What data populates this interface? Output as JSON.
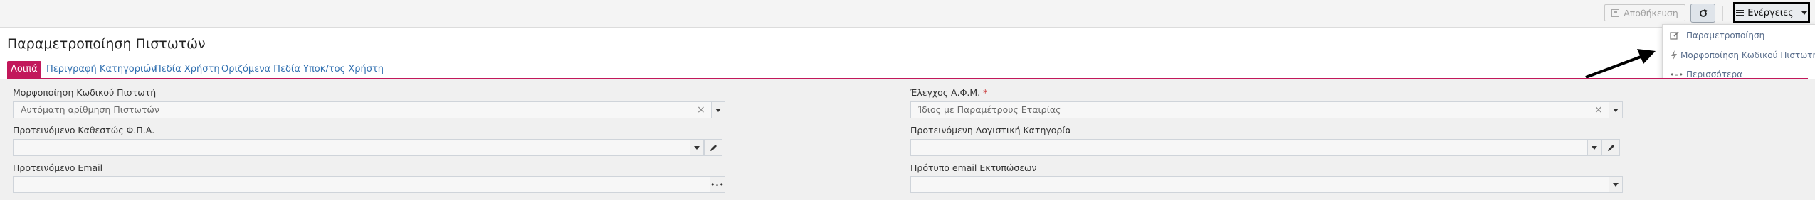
{
  "toolbar": {
    "save_label": "Αποθήκευση",
    "actions_label": "Ενέργειες"
  },
  "actions_menu": {
    "items": [
      {
        "label": "Παραμετροποίηση",
        "icon": "edit-icon"
      },
      {
        "label": "Μορφοποίηση Κωδικού Πιστωτή",
        "icon": "lightning-icon"
      },
      {
        "label": "Περισσότερα",
        "icon": "ellipsis-icon"
      }
    ]
  },
  "page": {
    "title": "Παραμετροποίηση Πιστωτών"
  },
  "tabs": [
    {
      "label": "Λοιπά",
      "active": true
    },
    {
      "label": "Περιγραφή Κατηγοριών",
      "active": false
    },
    {
      "label": "Πεδία Χρήστη",
      "active": false
    },
    {
      "label": "Οριζόμενα Πεδία Υποκ/τος Χρήστη",
      "active": false
    }
  ],
  "form": {
    "code_format": {
      "label": "Μορφοποίηση Κωδικού Πιστωτή",
      "value": "Αυτόματη αρίθμηση Πιστωτών"
    },
    "vat_check": {
      "label": "Έλεγχος Α.Φ.Μ.",
      "required_mark": "*",
      "value": "Ίδιος με Παραμέτρους Εταιρίας"
    },
    "vat_status": {
      "label": "Προτεινόμενο Καθεστώς Φ.Π.Α.",
      "value": ""
    },
    "accounting_category": {
      "label": "Προτεινόμενη Λογιστική Κατηγορία",
      "value": ""
    },
    "email": {
      "label": "Προτεινόμενο Email",
      "value": ""
    },
    "print_email_template": {
      "label": "Πρότυπο email Εκτυπώσεων",
      "value": ""
    }
  },
  "colors": {
    "accent": "#c2185b",
    "link": "#2f6fb0",
    "menu_text": "#5a6e8c"
  }
}
